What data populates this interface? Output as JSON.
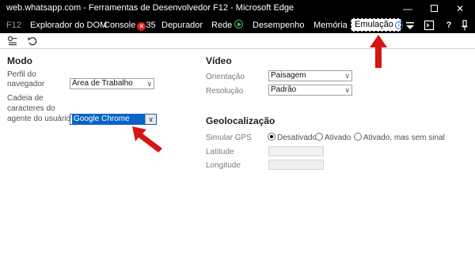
{
  "window": {
    "title": "web.whatsapp.com - Ferramentas de Desenvolvedor F12 - Microsoft Edge"
  },
  "tabs": {
    "f12": "F12",
    "dom": "Explorador do DOM",
    "console": "Console",
    "console_count": "35",
    "debugger": "Depurador",
    "network": "Rede",
    "performance": "Desempenho",
    "memory": "Memória",
    "emulation": "Emulação"
  },
  "modo": {
    "heading": "Modo",
    "profile_label_1": "Perfil do",
    "profile_label_2": "navegador",
    "profile_value": "Área de Trabalho",
    "ua_label_1": "Cadeia de",
    "ua_label_2": "caracteres do",
    "ua_label_3": "agente do usuário",
    "ua_value": "Google Chrome"
  },
  "video": {
    "heading": "Vídeo",
    "orientation_label": "Orientação",
    "orientation_value": "Paisagem",
    "resolution_label": "Resolução",
    "resolution_value": "Padrão"
  },
  "geo": {
    "heading": "Geolocalização",
    "gps_label": "Simular GPS",
    "options": [
      "Desativado",
      "Ativado",
      "Ativado, mas sem sinal"
    ],
    "selected": "Desativado",
    "latitude_label": "Latitude",
    "longitude_label": "Longitude"
  },
  "colors": {
    "accent": "#0a64c8",
    "annotation_arrow": "#d81515",
    "titlebar": "#000000"
  }
}
